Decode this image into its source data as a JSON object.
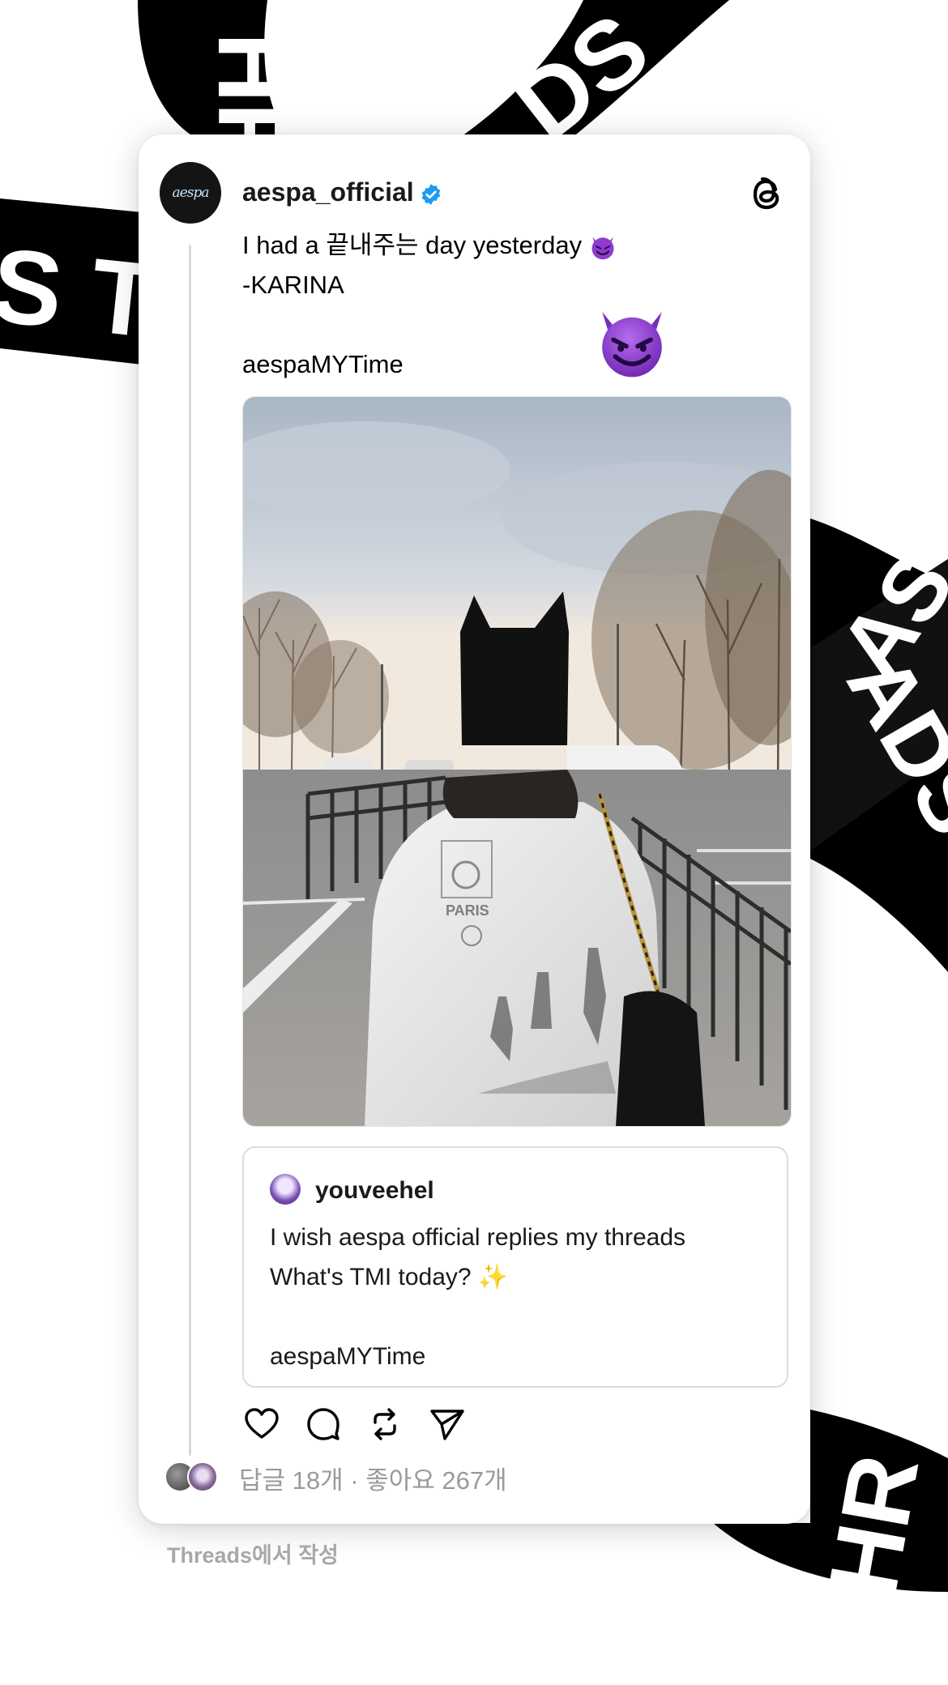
{
  "post": {
    "username": "aespa_official",
    "avatar_text": "aespa",
    "text_lines": [
      "I had a 끝내주는 day yesterday",
      "-KARINA",
      "",
      "aespaMYTime"
    ],
    "emoji_icon": "smiling-devil-emoji",
    "photo_alt": "Person in black cat-ear beanie and white sweatshirt with PARIS print, parking lot with trees",
    "photo_print_text": "PARIS",
    "quoted": {
      "username": "youveehel",
      "text_lines": [
        "I wish aespa official replies my threads",
        "What's TMI today? ✨",
        "",
        "aespaMYTime"
      ]
    },
    "actions": [
      "like",
      "reply",
      "repost",
      "share"
    ],
    "stats": "답글 18개 · 좋아요 267개"
  },
  "caption": "Threads에서 작성",
  "ribbon_text": "THREADS",
  "colors": {
    "verified": "#1d9bf0",
    "ribbon": "#000000",
    "muted": "#9a9a9a",
    "devil_purple": "#8e3bd1"
  }
}
